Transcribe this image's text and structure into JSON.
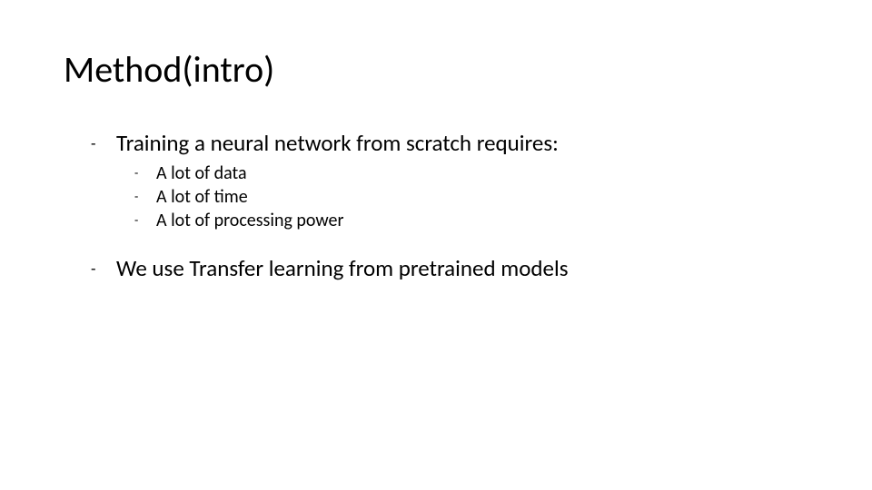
{
  "slide": {
    "title": "Method(intro)",
    "points": [
      {
        "text": "Training a neural network from scratch requires:",
        "sub": [
          "A lot of data",
          "A lot of time",
          "A lot of processing power"
        ]
      },
      {
        "text": "We use Transfer learning from pretrained models",
        "sub": []
      }
    ]
  }
}
